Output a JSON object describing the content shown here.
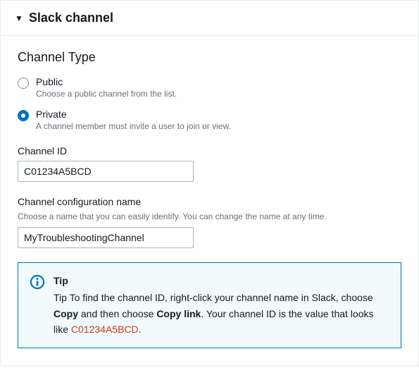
{
  "header": {
    "title": "Slack channel"
  },
  "channelType": {
    "title": "Channel Type",
    "options": [
      {
        "label": "Public",
        "desc": "Choose a public channel from the list.",
        "selected": false
      },
      {
        "label": "Private",
        "desc": "A channel member must invite a user to join or view.",
        "selected": true
      }
    ]
  },
  "channelId": {
    "label": "Channel ID",
    "value": "C01234A5BCD"
  },
  "configName": {
    "label": "Channel configuration name",
    "helper": "Choose a name that you can easily identify. You can change the name at any time.",
    "value": "MyTroubleshootingChannel"
  },
  "tip": {
    "title": "Tip",
    "text_prefix": "Tip To find the channel ID, right-click your channel name in Slack, choose ",
    "copy": "Copy",
    "mid1": " and then choose ",
    "copylink": "Copy link",
    "mid2": ". Your channel ID is the value that looks like ",
    "example": "C01234A5BCD",
    "suffix": "."
  }
}
